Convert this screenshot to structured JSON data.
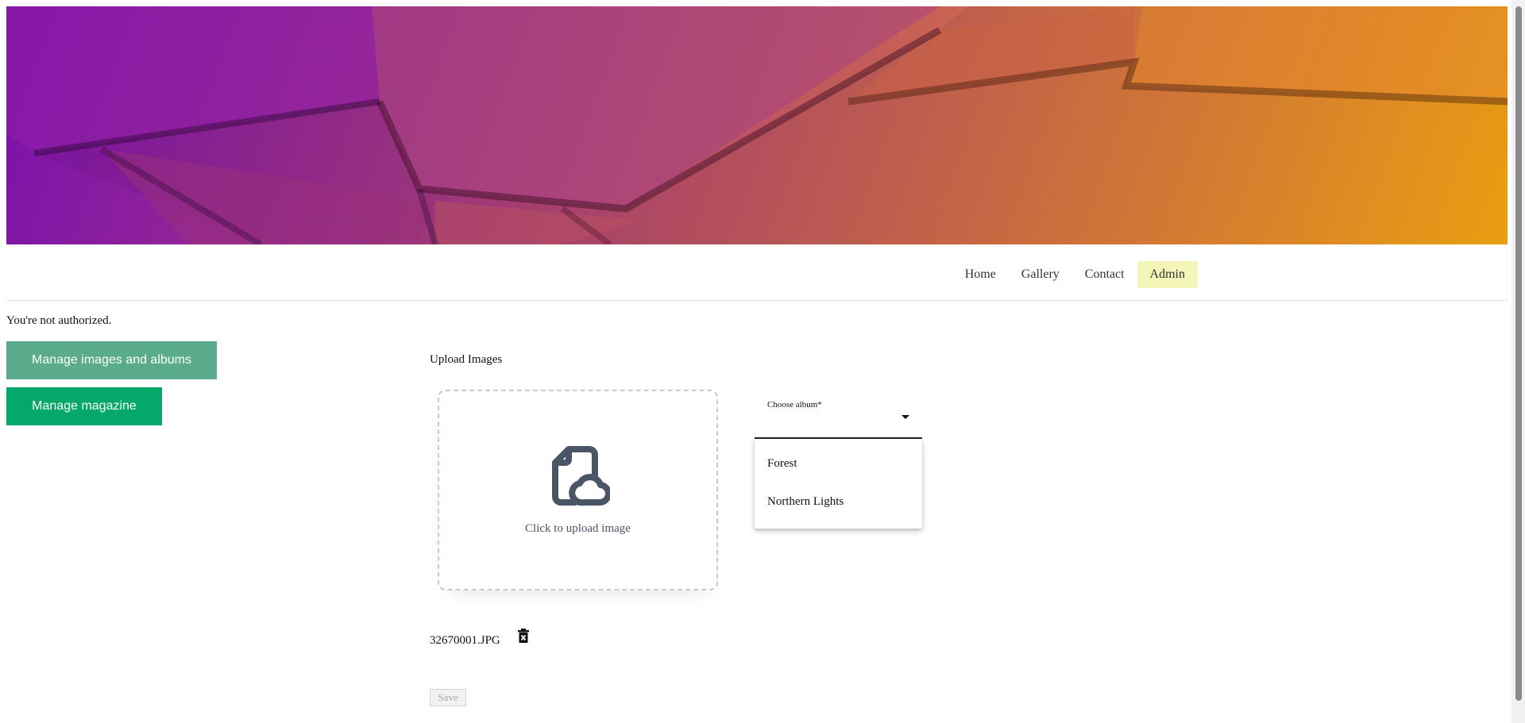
{
  "navigation": {
    "items": [
      {
        "label": "Home"
      },
      {
        "label": "Gallery"
      },
      {
        "label": "Contact"
      },
      {
        "label": "Admin"
      }
    ],
    "active": "Admin"
  },
  "auth_message": "You're not authorized.",
  "sidebar": {
    "manage_images_label": "Manage images and albums",
    "manage_magazine_label": "Manage magazine"
  },
  "upload": {
    "title": "Upload Images",
    "dropzone_caption": "Click to upload image",
    "album_select_label": "Choose album*",
    "album_options": [
      "Forest",
      "Northern Lights"
    ],
    "files": [
      "32670001.JPG"
    ],
    "save_label": "Save"
  },
  "colors": {
    "nav_active_bg": "#f4f5b9",
    "manage_images_bg": "#5aab8c",
    "manage_magazine_bg": "#03a86a"
  },
  "icons": {
    "upload": "file-cloud-icon",
    "delete": "trash-x-icon",
    "dropdown": "caret-down-icon"
  }
}
